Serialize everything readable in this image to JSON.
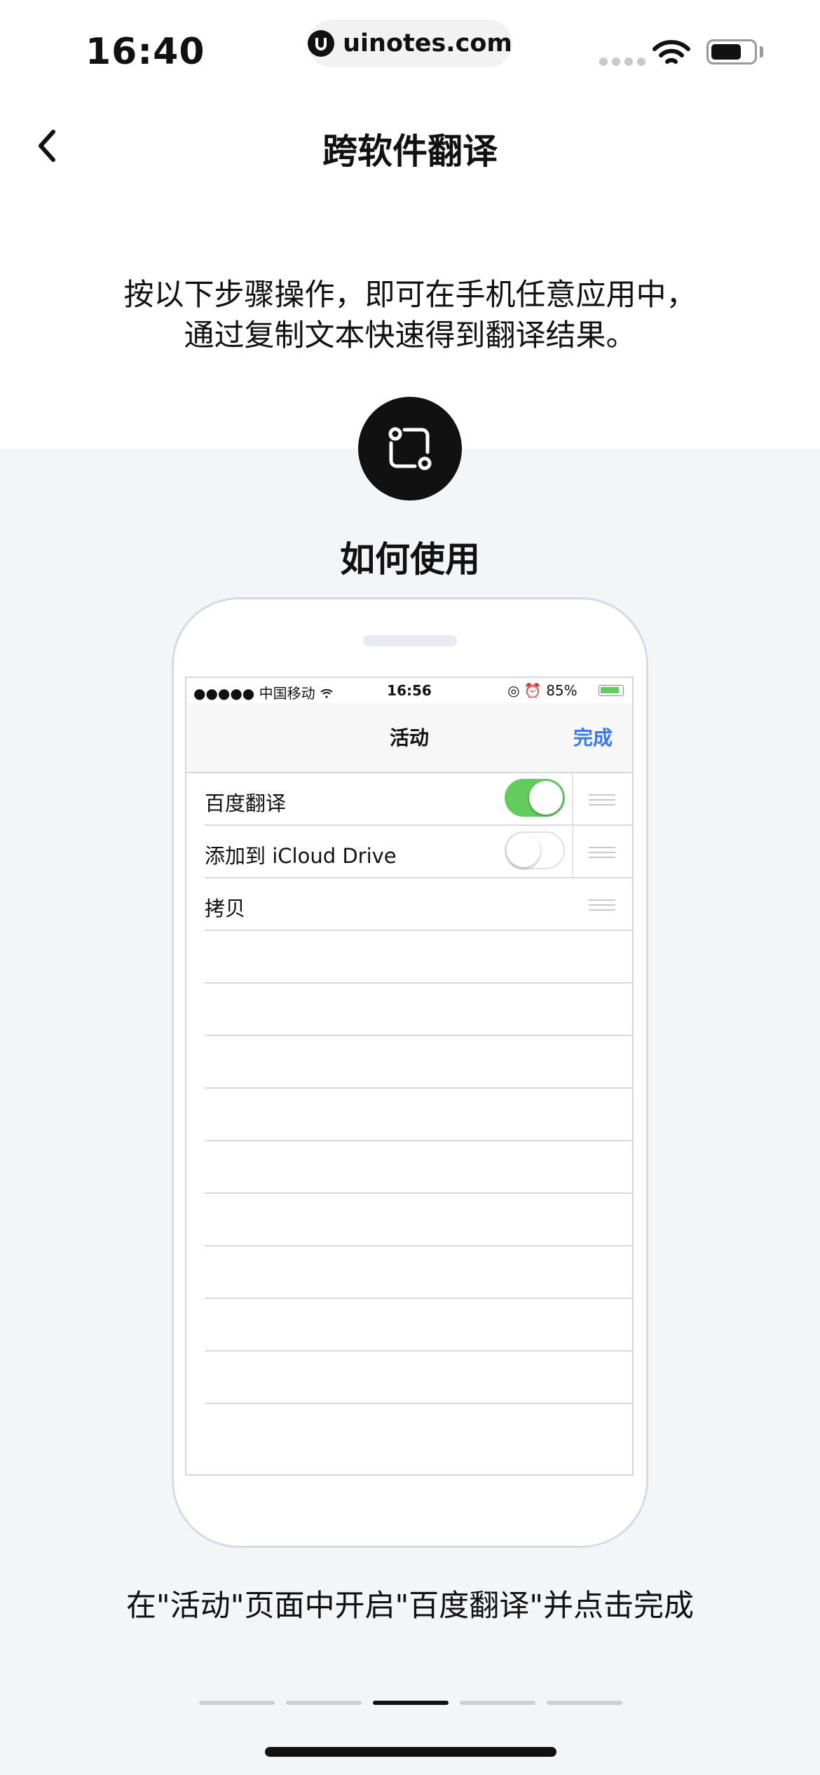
{
  "status_bar": {
    "time": "16:40",
    "url": "uinotes.com",
    "icons": [
      "signal-dots-icon",
      "wifi-icon",
      "battery-icon"
    ]
  },
  "nav": {
    "back_icon": "chevron-left-icon",
    "title": "跨软件翻译"
  },
  "intro": {
    "line1": "按以下步骤操作，即可在手机任意应用中，",
    "line2": "通过复制文本快速得到翻译结果。"
  },
  "section": {
    "icon": "scan-crop-icon",
    "title": "如何使用"
  },
  "mock_phone": {
    "status": {
      "carrier": "●●●●● 中国移动 ",
      "time": "16:56",
      "battery": "85%"
    },
    "nav_title": "活动",
    "done_label": "完成",
    "rows": [
      {
        "label": "百度翻译",
        "toggle": "on"
      },
      {
        "label": "添加到 iCloud Drive",
        "toggle": "off"
      },
      {
        "label": "拷贝"
      }
    ]
  },
  "caption": "在\"活动\"页面中开启\"百度翻译\"并点击完成",
  "pager": {
    "count": 5,
    "active_index": 2
  },
  "colors": {
    "accent_blue": "#3478f6",
    "toggle_green": "#62cc5f",
    "background_gray": "#f4f5f7",
    "text_dark": "#111111"
  }
}
